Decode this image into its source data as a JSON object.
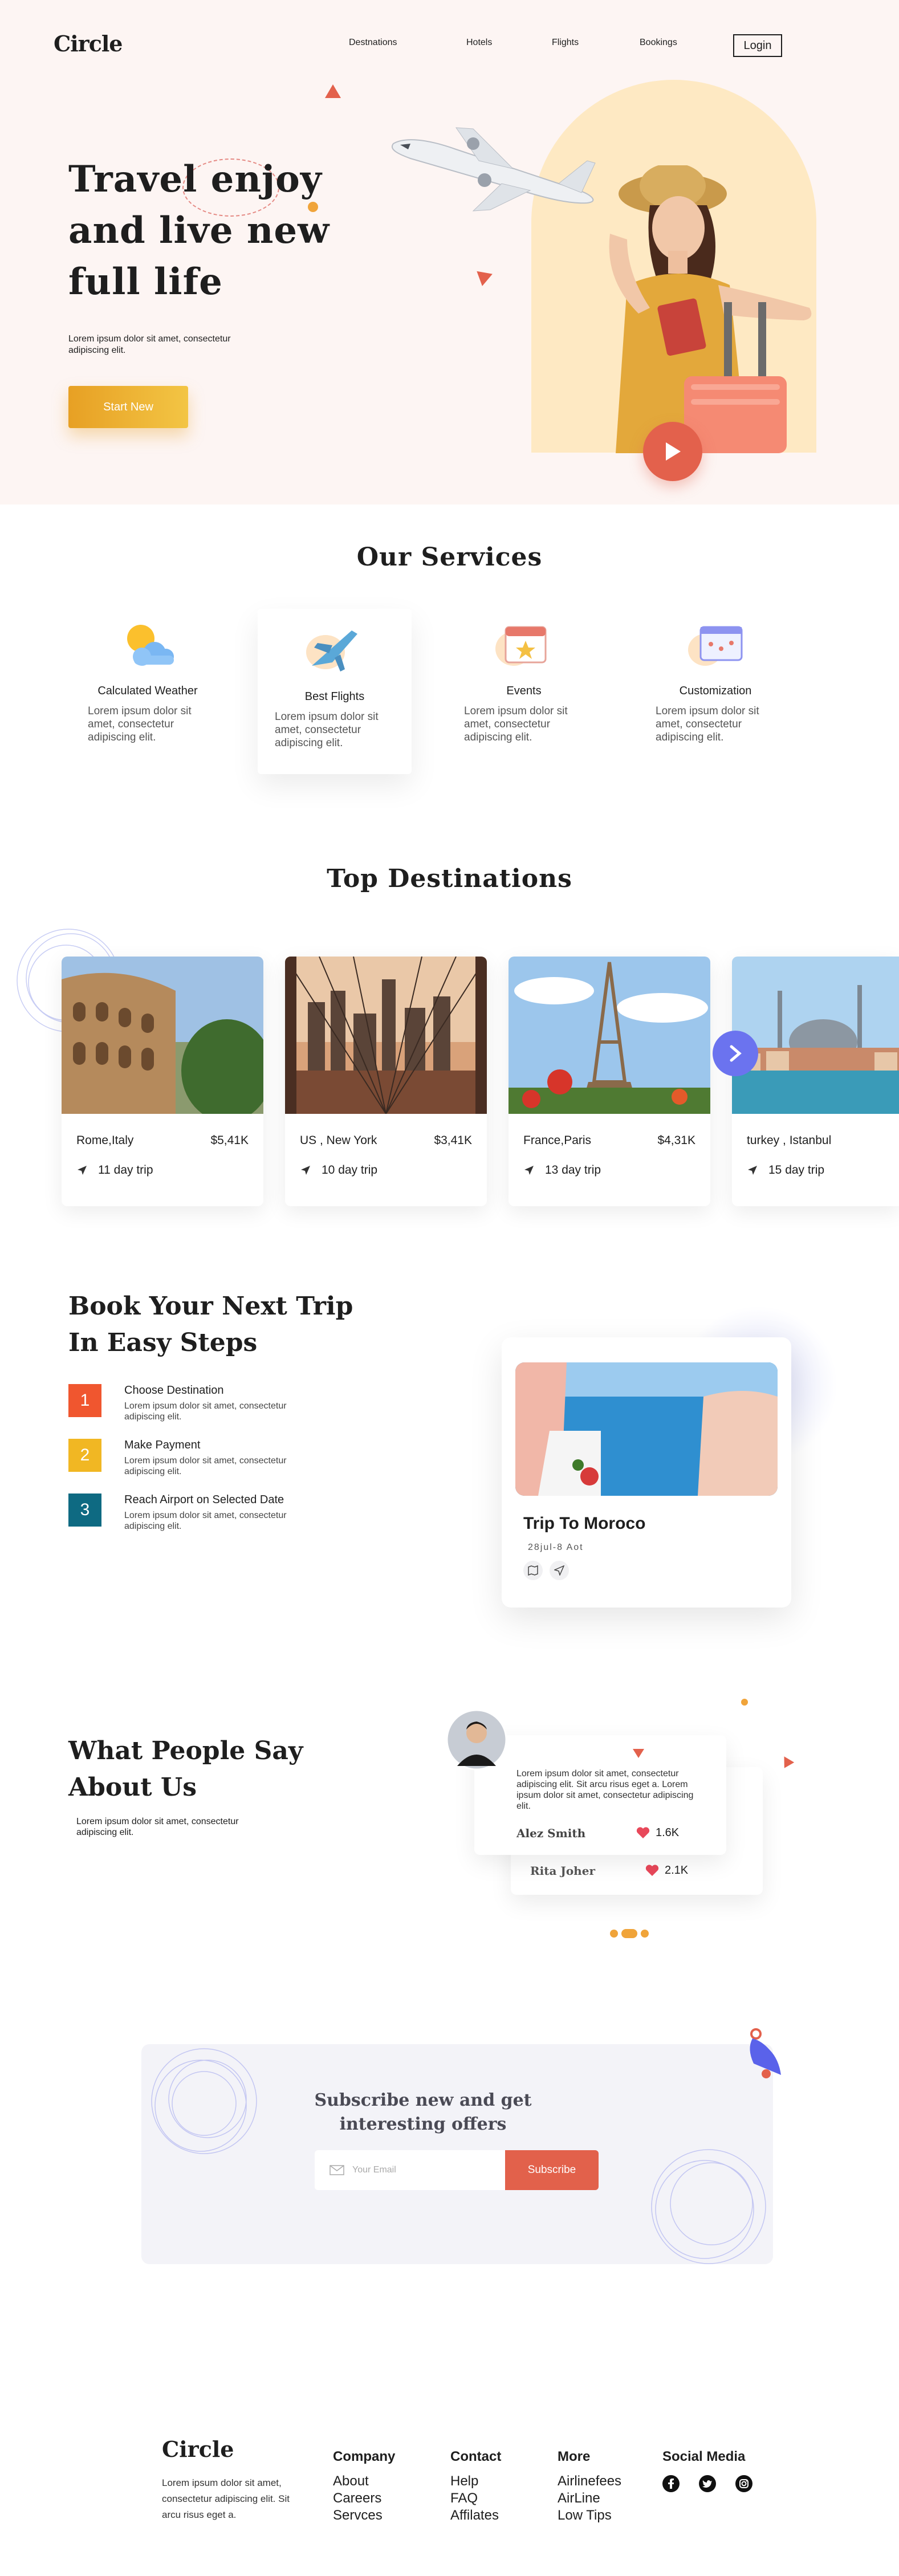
{
  "header": {
    "logo": "Circle",
    "nav": [
      "Destnations",
      "Hotels",
      "Flights",
      "Bookings"
    ],
    "login": "Login"
  },
  "hero": {
    "title_lines": [
      "Travel enjoy",
      "and live new",
      "full life"
    ],
    "subtitle": "Lorem ipsum dolor sit amet, consectetur adipiscing elit.",
    "cta": "Start New"
  },
  "services": {
    "title": "Our Services",
    "items": [
      {
        "title": "Calculated Weather",
        "desc": "Lorem ipsum dolor sit amet, consectetur adipiscing elit.",
        "icon": "weather-icon"
      },
      {
        "title": "Best Flights",
        "desc": "Lorem ipsum dolor sit amet, consectetur adipiscing elit.",
        "icon": "airplane-icon"
      },
      {
        "title": "Events",
        "desc": "Lorem ipsum dolor sit amet, consectetur adipiscing elit.",
        "icon": "calendar-icon"
      },
      {
        "title": "Customization",
        "desc": "Lorem ipsum dolor sit amet, consectetur adipiscing elit.",
        "icon": "settings-window-icon"
      }
    ]
  },
  "destinations": {
    "title": "Top Destinations",
    "items": [
      {
        "place": "Rome,Italy",
        "price": "$5,41K",
        "trip": "11 day trip"
      },
      {
        "place": "US , New York",
        "price": "$3,41K",
        "trip": "10 day trip"
      },
      {
        "place": "France,Paris",
        "price": "$4,31K",
        "trip": "13 day trip"
      },
      {
        "place": "turkey , Istanbul",
        "price": "",
        "trip": "15 day trip"
      }
    ]
  },
  "steps": {
    "title_lines": [
      "Book Your Next Trip",
      "In Easy Steps"
    ],
    "items": [
      {
        "num": "1",
        "title": "Choose Destination",
        "desc": "Lorem ipsum dolor sit amet, consectetur adipiscing elit.",
        "color": "#f0562f"
      },
      {
        "num": "2",
        "title": "Make Payment",
        "desc": "Lorem ipsum dolor sit amet, consectetur adipiscing elit.",
        "color": "#f1b723"
      },
      {
        "num": "3",
        "title": "Reach Airport on Selected Date",
        "desc": "Lorem ipsum dolor sit amet, consectetur adipiscing elit.",
        "color": "#0e6a82"
      }
    ],
    "trip_card": {
      "title": "Trip To Moroco",
      "date": "28jul-8 Aot"
    }
  },
  "testimonials": {
    "title_lines": [
      "What People Say",
      "About Us"
    ],
    "desc": "Lorem ipsum dolor sit amet, consectetur adipiscing elit.",
    "cards": [
      {
        "text": "Lorem ipsum dolor sit amet, consectetur adipiscing elit. Sit arcu risus eget a. Lorem ipsum dolor sit amet, consectetur adipiscing elit.",
        "name": "Alez Smith",
        "likes": "1.6K"
      },
      {
        "text": "",
        "name": "Rita Joher",
        "likes": "2.1K"
      }
    ]
  },
  "subscribe": {
    "title_lines": [
      "Subscribe new and get",
      "interesting offers"
    ],
    "placeholder": "Your Email",
    "button": "Subscribe"
  },
  "footer": {
    "logo": "Circle",
    "desc": "Lorem ipsum dolor sit amet, consectetur adipiscing elit. Sit arcu risus eget a.",
    "columns": [
      {
        "title": "Company",
        "links": [
          "About",
          "Careers",
          "Servces"
        ]
      },
      {
        "title": "Contact",
        "links": [
          "Help",
          "FAQ",
          "Affilates"
        ]
      },
      {
        "title": "More",
        "links": [
          "Airlinefees",
          "AirLine",
          "Low Tips"
        ]
      }
    ],
    "social_title": "Social Media",
    "social": [
      "facebook-icon",
      "twitter-icon",
      "instagram-icon"
    ]
  },
  "colors": {
    "accent": "#e3614c",
    "gold": "#e7a024",
    "hero_bg": "#fdf5f3",
    "arch": "#fee9c3",
    "purple": "#6b73ef"
  }
}
